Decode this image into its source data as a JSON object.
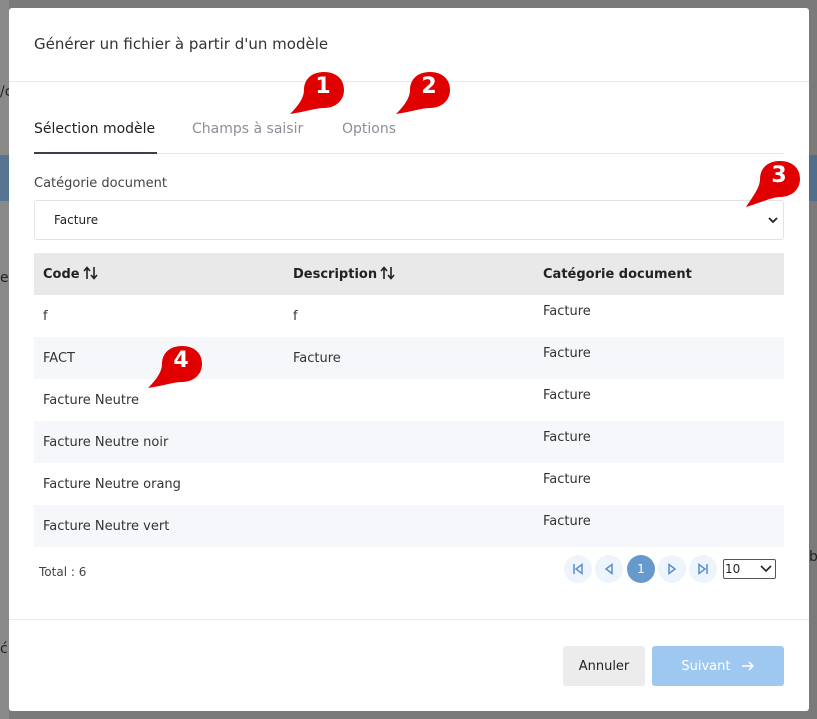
{
  "background": {
    "fragment_top": "/c",
    "fragment_left": "es",
    "fragment_bottom": "ć",
    "fragment_right": "b"
  },
  "modal": {
    "title": "Générer un fichier à partir d'un modèle"
  },
  "tabs": [
    {
      "label": "Sélection modèle",
      "active": true
    },
    {
      "label": "Champs à saisir",
      "active": false
    },
    {
      "label": "Options",
      "active": false
    }
  ],
  "category": {
    "label": "Catégorie document",
    "value": "Facture"
  },
  "table": {
    "headers": [
      "Code",
      "Description",
      "Catégorie document"
    ],
    "rows": [
      {
        "code": "f",
        "description": "f",
        "category": "Facture"
      },
      {
        "code": "FACT",
        "description": "Facture",
        "category": "Facture"
      },
      {
        "code": "Facture Neutre",
        "description": "",
        "category": "Facture"
      },
      {
        "code": "Facture Neutre noir",
        "description": "",
        "category": "Facture"
      },
      {
        "code": "Facture Neutre orang",
        "description": "",
        "category": "Facture"
      },
      {
        "code": "Facture Neutre vert",
        "description": "",
        "category": "Facture"
      }
    ]
  },
  "pagination": {
    "total": "Total : 6",
    "current_page": "1",
    "page_size": "10"
  },
  "footer": {
    "cancel": "Annuler",
    "next": "Suivant"
  },
  "markers": [
    "1",
    "2",
    "3",
    "4"
  ],
  "colors": {
    "accent": "#6699cc",
    "primary_disabled": "#9ec8ef",
    "marker": "#e00000",
    "header_bg": "#e9e9e9"
  }
}
